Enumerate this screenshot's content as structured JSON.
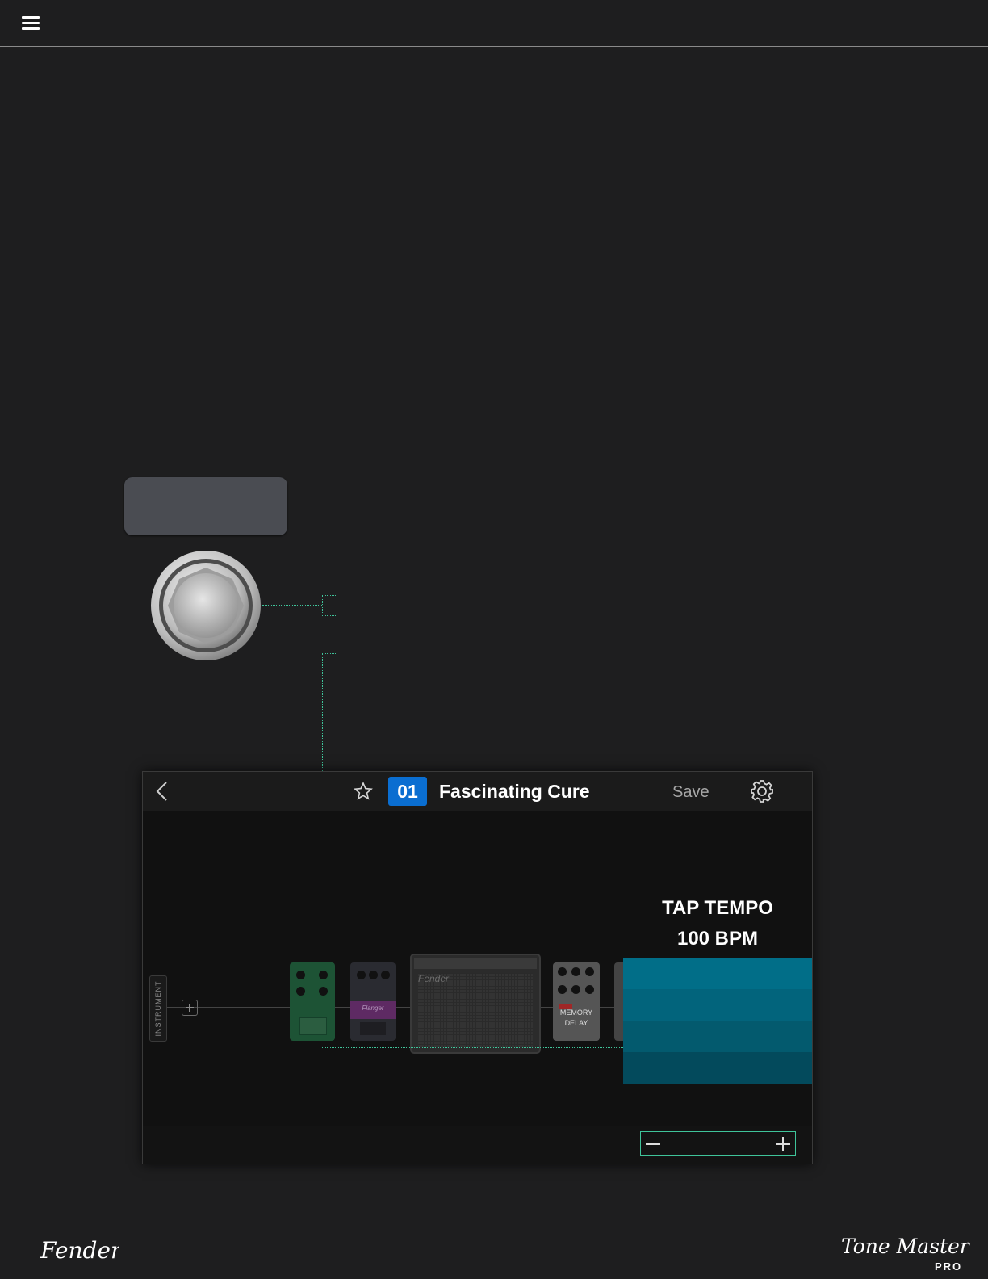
{
  "header": {
    "menu_icon": "hamburger-menu-icon"
  },
  "device": {
    "preset_number": "01",
    "preset_name": "Fascinating Cure",
    "save_label": "Save",
    "icons": {
      "back": "chevron-left-icon",
      "favorite": "star-icon",
      "settings": "gear-icon"
    },
    "signal_chain": {
      "input_label": "INSTRUMENT",
      "add_icon": "plus-square-icon",
      "blocks": [
        "green-overdrive-pedal",
        "purple-flanger-pedal",
        "fender-amp",
        "memory-delay-pedal"
      ]
    },
    "tap_tempo": {
      "title": "TAP TEMPO",
      "bpm_text": "100 BPM",
      "bpm": 100,
      "bar_colors": [
        "#016e88",
        "#02647c",
        "#035a6e",
        "#034a5c"
      ]
    },
    "stepper": {
      "minus_icon": "minus-icon",
      "plus_icon": "plus-icon"
    }
  },
  "pedal_text": {
    "delay_line1": "MEMORY",
    "delay_line2": "DELAY"
  },
  "branding": {
    "left_logo": "Fender",
    "right_logo": "Tone Master",
    "right_logo_sub": "PRO"
  },
  "colors": {
    "background": "#1e1e1f",
    "accent": "#3fc49a",
    "preset_badge": "#0a6ed1"
  }
}
